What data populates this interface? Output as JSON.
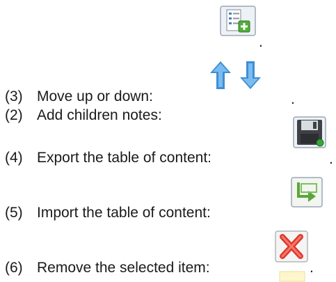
{
  "items": [
    {
      "number": "(2)",
      "text": "Add children notes:",
      "suffix": ".",
      "icon": "add-children-notes-icon"
    },
    {
      "number": "(3)",
      "text": "Move up or down:",
      "suffix": ".",
      "icons": [
        "arrow-up-icon",
        "arrow-down-icon"
      ]
    },
    {
      "number": "(4)",
      "text": "Export the table of content:",
      "suffix": ".",
      "icon": "floppy-disk-icon"
    },
    {
      "number": "(5)",
      "text": "Import the table of content:",
      "suffix": "",
      "icon": "import-arrow-icon"
    },
    {
      "number": "(6)",
      "text": "Remove the selected item:",
      "suffix": ".",
      "icon": "red-x-icon"
    }
  ],
  "colors": {
    "arrow_blue": "#3d8fd6",
    "remove_red": "#e0392b",
    "import_green": "#5aa63b"
  }
}
